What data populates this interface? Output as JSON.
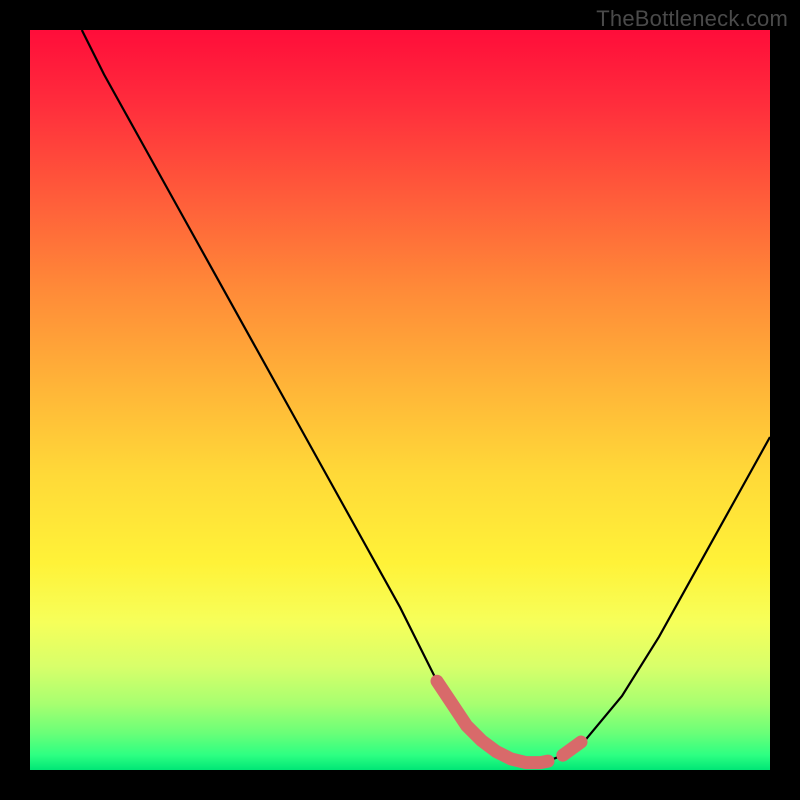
{
  "watermark": "TheBottleneck.com",
  "colors": {
    "gradient_top": "#ff0d3a",
    "gradient_mid": "#ffd938",
    "gradient_bottom": "#00e676",
    "frame": "#000000",
    "line": "#000000",
    "highlight": "#d86a6a"
  },
  "chart_data": {
    "type": "line",
    "title": "",
    "xlabel": "",
    "ylabel": "",
    "xlim": [
      0,
      100
    ],
    "ylim": [
      0,
      100
    ],
    "grid": false,
    "legend": false,
    "series": [
      {
        "name": "bottleneck-curve",
        "x": [
          7,
          10,
          15,
          20,
          25,
          30,
          35,
          40,
          45,
          50,
          53,
          55,
          57,
          59,
          61,
          63,
          65,
          67,
          69,
          70,
          72,
          75,
          80,
          85,
          90,
          95,
          100
        ],
        "y": [
          100,
          94,
          85,
          76,
          67,
          58,
          49,
          40,
          31,
          22,
          16,
          12,
          9,
          6,
          4,
          2.5,
          1.5,
          1,
          1,
          1.2,
          2,
          4,
          10,
          18,
          27,
          36,
          45
        ]
      }
    ],
    "annotations": [
      {
        "name": "sweet-spot-left",
        "x_range": [
          55,
          70
        ],
        "note": "highlighted pink segment along minimum"
      },
      {
        "name": "sweet-spot-right",
        "x_range": [
          72,
          74
        ],
        "note": "short separate pink segment on rising edge"
      }
    ]
  }
}
